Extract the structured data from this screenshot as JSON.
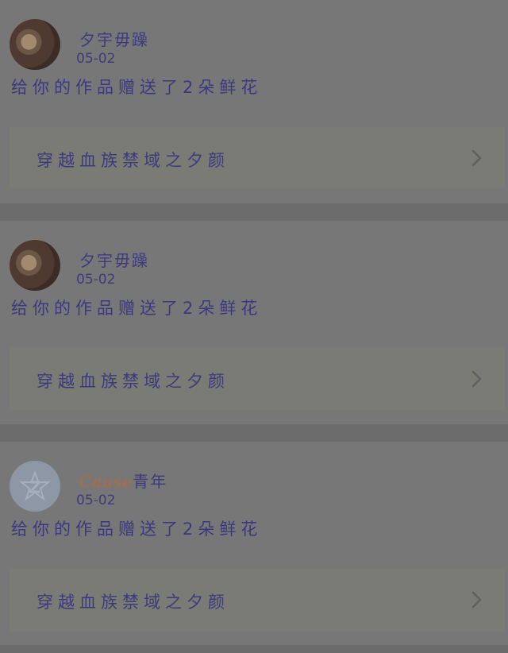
{
  "notifications": [
    {
      "name": "夕宇毋躁",
      "name_latin": "",
      "date": "05-02",
      "message": "给你的作品赠送了2朵鲜花",
      "work_title": "穿越血族禁域之夕颜",
      "avatar_type": "photo",
      "chevron_icon": "chevron-right-icon"
    },
    {
      "name": "夕宇毋躁",
      "name_latin": "",
      "date": "05-02",
      "message": "给你的作品赠送了2朵鲜花",
      "work_title": "穿越血族禁域之夕颜",
      "avatar_type": "photo",
      "chevron_icon": "chevron-right-icon"
    },
    {
      "name": "青年",
      "name_latin": "Cause",
      "date": "05-02",
      "message": "给你的作品赠送了2朵鲜花",
      "work_title": "穿越血族禁域之夕颜",
      "avatar_type": "default-qq",
      "chevron_icon": "chevron-right-icon"
    }
  ],
  "colors": {
    "overlay_bg": "#6b6b6b",
    "card_bg": "#777777",
    "item_bg": "#797b74",
    "text_primary": "#3b3880",
    "name_latin": "#b06b3e"
  }
}
